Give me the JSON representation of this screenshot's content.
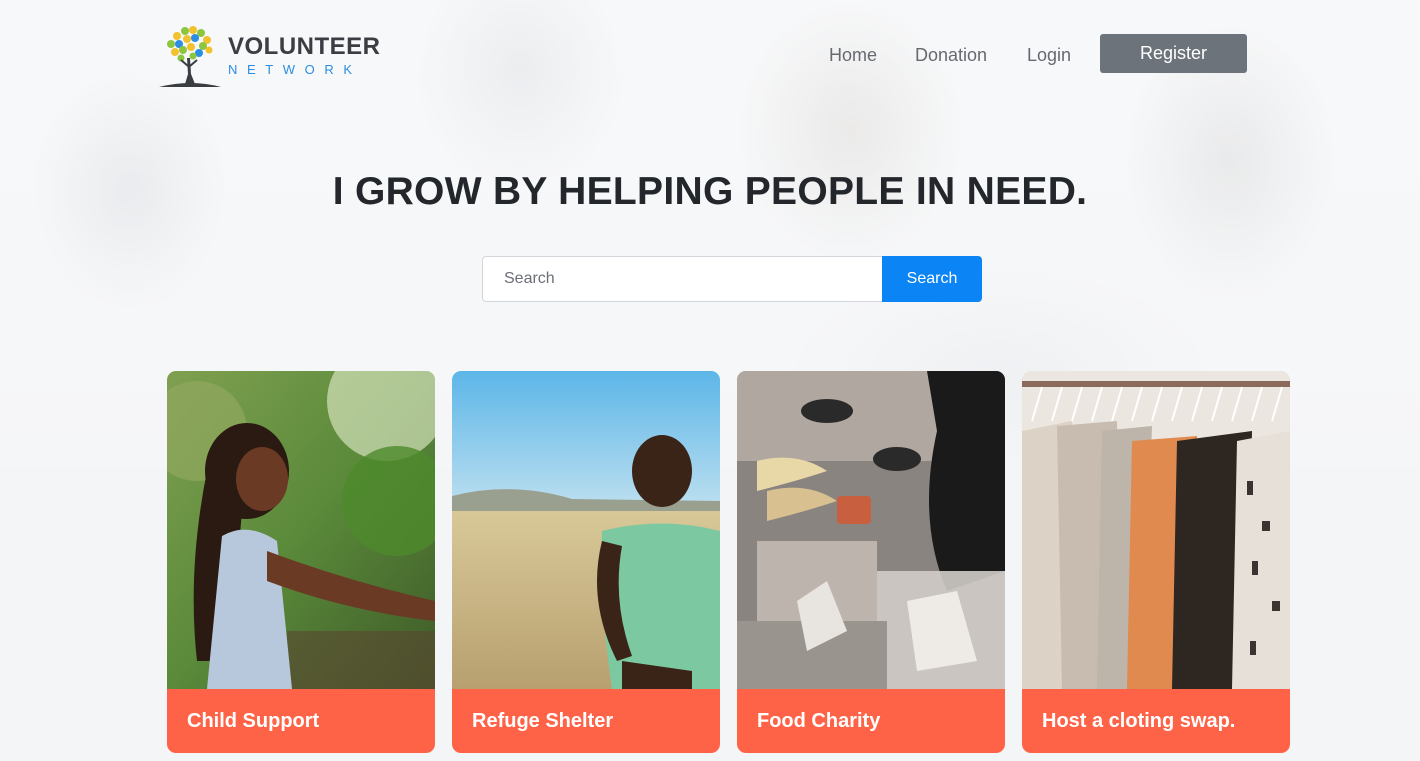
{
  "logo": {
    "title": "VOLUNTEER",
    "subtitle": "NETWORK",
    "accent": "#2b8de3"
  },
  "nav": {
    "home": "Home",
    "donation": "Donation",
    "login": "Login",
    "register": "Register"
  },
  "hero": {
    "title": "I GROW BY HELPING PEOPLE IN NEED."
  },
  "search": {
    "placeholder": "Search",
    "button": "Search",
    "button_color": "#0b84f5"
  },
  "cards": [
    {
      "label": "Child Support"
    },
    {
      "label": "Refuge Shelter"
    },
    {
      "label": "Food Charity"
    },
    {
      "label": "Host a cloting swap."
    }
  ],
  "colors": {
    "card_label_bg": "#ff6347",
    "register_bg": "#6c737b"
  }
}
